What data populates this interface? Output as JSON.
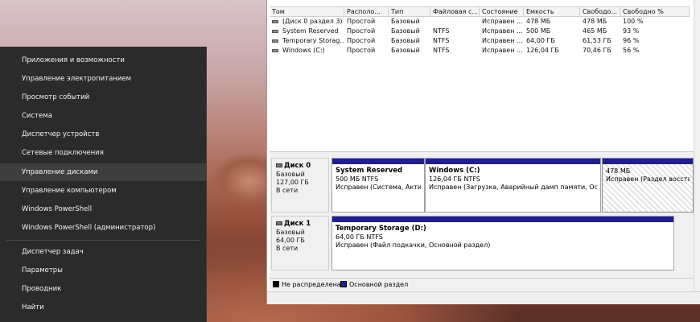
{
  "winx_menu": {
    "items": [
      {
        "label": "Приложения и возможности"
      },
      {
        "label": "Управление электропитанием"
      },
      {
        "label": "Просмотр событий"
      },
      {
        "label": "Система"
      },
      {
        "label": "Диспетчер устройств"
      },
      {
        "label": "Сетевые подключения"
      },
      {
        "label": "Управление дисками"
      },
      {
        "label": "Управление компьютером"
      },
      {
        "label": "Windows PowerShell"
      },
      {
        "label": "Windows PowerShell (администратор)"
      },
      {
        "label": "Диспетчер задач"
      },
      {
        "label": "Параметры"
      },
      {
        "label": "Проводник"
      },
      {
        "label": "Найти"
      }
    ],
    "highlighted": "Управление дисками"
  },
  "volume_table": {
    "columns": [
      "Том",
      "Располо...",
      "Тип",
      "Файловая с...",
      "Состояние",
      "Емкость",
      "Свободо...",
      "Свободно %"
    ],
    "rows": [
      [
        "(Диск 0 раздел 3)",
        "Простой",
        "Базовый",
        "",
        "Исправен ...",
        "478 МБ",
        "478 МБ",
        "100 %"
      ],
      [
        "System Reserved",
        "Простой",
        "Базовый",
        "NTFS",
        "Исправен ...",
        "500 МБ",
        "465 МБ",
        "93 %"
      ],
      [
        "Temporary Storag...",
        "Простой",
        "Базовый",
        "NTFS",
        "Исправен ...",
        "64,00 ГБ",
        "61,53 ГБ",
        "96 %"
      ],
      [
        "Windows (C:)",
        "Простой",
        "Базовый",
        "NTFS",
        "Исправен ...",
        "126,04 ГБ",
        "70,46 ГБ",
        "56 %"
      ]
    ]
  },
  "disks": [
    {
      "name": "Диск 0",
      "type": "Базовый",
      "size": "127,00 ГБ",
      "status": "В сети",
      "partitions": [
        {
          "title": "System Reserved",
          "size": "500 МБ NTFS",
          "status": "Исправен (Система, Актив"
        },
        {
          "title": "Windows  (C:)",
          "size": "126,04 ГБ NTFS",
          "status": "Исправен (Загрузка, Аварийный дамп памяти, Осно"
        },
        {
          "title": "",
          "size": "478 МБ",
          "status": "Исправен (Раздел восстан"
        }
      ]
    },
    {
      "name": "Диск 1",
      "type": "Базовый",
      "size": "64,00 ГБ",
      "status": "В сети",
      "partitions": [
        {
          "title": "Temporary Storage  (D:)",
          "size": "64,00 ГБ NTFS",
          "status": "Исправен (Файл подкачки, Основной раздел)"
        }
      ]
    }
  ],
  "legend": {
    "unallocated": {
      "label": "Не распределена",
      "color": "#000000"
    },
    "primary": {
      "label": "Основной раздел",
      "color": "#1f1f8f"
    }
  }
}
